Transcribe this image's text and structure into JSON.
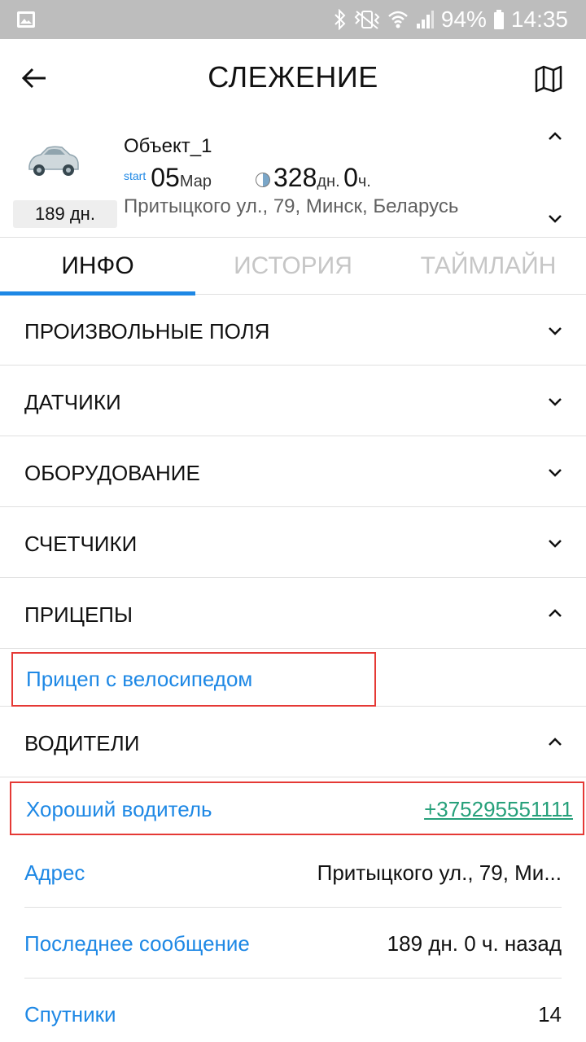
{
  "status_bar": {
    "battery": "94%",
    "time": "14:35",
    "icons": [
      "gallery-icon",
      "bluetooth-icon",
      "vibrate-icon",
      "wifi-icon",
      "signal-icon",
      "battery-icon"
    ]
  },
  "app_bar": {
    "title": "СЛЕЖЕНИЕ",
    "back_icon": "arrow-left-icon",
    "map_icon": "map-icon"
  },
  "object_card": {
    "name": "Объект_1",
    "badge": "189 дн.",
    "start_label": "start",
    "start_day": "05",
    "start_month": "Мар",
    "duration_days": "328",
    "duration_days_unit": "дн.",
    "duration_hours": "0",
    "duration_hours_unit": "ч.",
    "address": "Притыцкого ул., 79, Минск, Беларусь"
  },
  "tabs": [
    {
      "label": "ИНФО",
      "active": true
    },
    {
      "label": "ИСТОРИЯ",
      "active": false
    },
    {
      "label": "ТАЙМЛАЙН",
      "active": false
    }
  ],
  "sections": [
    {
      "label": "ПРОИЗВОЛЬНЫЕ ПОЛЯ",
      "expanded": false
    },
    {
      "label": "ДАТЧИКИ",
      "expanded": false
    },
    {
      "label": "ОБОРУДОВАНИЕ",
      "expanded": false
    },
    {
      "label": "СЧЕТЧИКИ",
      "expanded": false
    },
    {
      "label": "ПРИЦЕПЫ",
      "expanded": true
    },
    {
      "label": "ВОДИТЕЛИ",
      "expanded": true
    }
  ],
  "trailer": {
    "name": "Прицеп с велосипедом"
  },
  "driver": {
    "name": "Хороший водитель",
    "phone": "+375295551111"
  },
  "details": [
    {
      "key": "Адрес",
      "value": "Притыцкого ул., 79, Ми..."
    },
    {
      "key": "Последнее сообщение",
      "value": "189 дн. 0 ч. назад"
    },
    {
      "key": "Спутники",
      "value": "14"
    }
  ],
  "colors": {
    "accent": "#1e88e5",
    "phone": "#26a07a",
    "highlight_border": "#e53935",
    "status_bar": "#bdbdbd"
  }
}
